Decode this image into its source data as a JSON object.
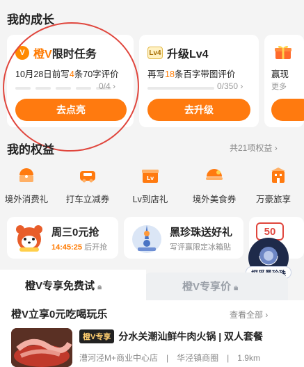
{
  "growth": {
    "title": "我的成长",
    "task_card": {
      "badge": "V",
      "name_accent": "橙V",
      "name_rest": "限时任务",
      "desc_prefix": "10月28日前写",
      "desc_num": "4",
      "desc_suffix": "条70字评价",
      "progress": "0/4",
      "progress_fraction": 0,
      "button": "去点亮"
    },
    "level_card": {
      "badge": "Lv4",
      "name": "升级Lv4",
      "desc_prefix": "再写",
      "desc_num": "18",
      "desc_suffix": "条百字带图评价",
      "progress": "0/350",
      "progress_fraction": 0,
      "button": "去升级"
    },
    "third_card": {
      "line1": "赢现",
      "line2": "更多"
    }
  },
  "benefits": {
    "title": "我的权益",
    "count_link": "共21项权益",
    "items": [
      {
        "label": "境外消费礼",
        "icon": "overseas-spend-icon"
      },
      {
        "label": "打车立减券",
        "icon": "taxi-coupon-icon"
      },
      {
        "label": "Lv到店礼",
        "icon": "lv-store-gift-icon"
      },
      {
        "label": "境外美食券",
        "icon": "overseas-food-icon"
      },
      {
        "label": "万豪旅享",
        "icon": "marriott-icon"
      }
    ]
  },
  "promos": {
    "first": {
      "title": "周三0元抢",
      "time": "14:45:25",
      "time_suffix": "后开抢"
    },
    "second": {
      "title": "黑珍珠送好礼",
      "sub": "写评赢限定冰箱贴"
    },
    "third": {
      "title": "50",
      "overlay_caption": "探觅黑珍珠"
    }
  },
  "tabs": {
    "active": "橙V专享免费试",
    "inactive": "橙V专享价"
  },
  "list": {
    "title": "橙V立享0元吃喝玩乐",
    "view_all": "查看全部",
    "item": {
      "tag": "橙V专享",
      "name": "分水关潮汕鲜牛肉火锅 | 双人套餐",
      "location": "漕河泾M+商业中心店",
      "area": "华泾镇商圈",
      "distance": "1.9km"
    }
  },
  "colors": {
    "accent": "#ff7a0f",
    "annotation": "#e0463d"
  }
}
